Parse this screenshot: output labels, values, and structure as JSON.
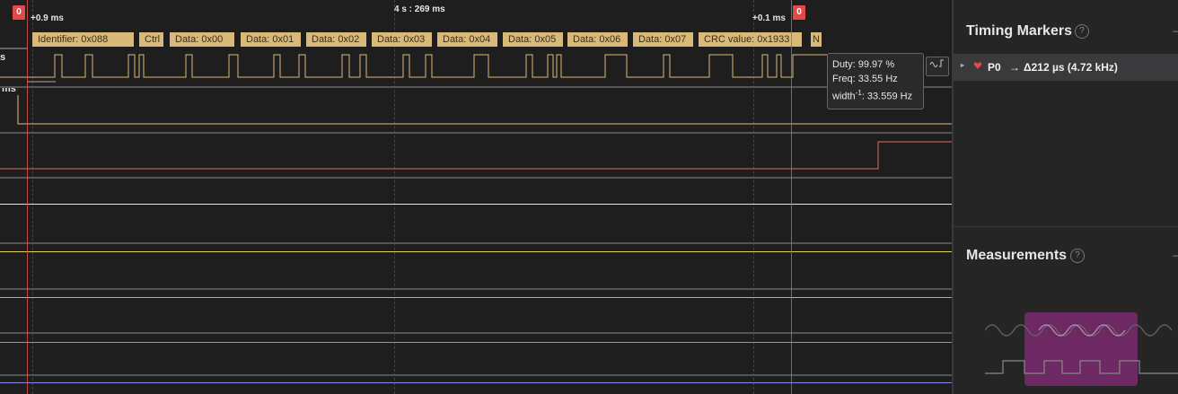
{
  "header": {
    "center_time": "4 s : 269 ms",
    "left_delta": "+0.9 ms",
    "right_delta": "+0.1 ms"
  },
  "markers": {
    "left_flag": "0",
    "right_flag": "0"
  },
  "left_labels": {
    "row1": "s",
    "row2": "ms"
  },
  "packets": [
    "Identifier: 0x088",
    "Ctrl",
    "Data: 0x00",
    "Data: 0x01",
    "Data: 0x02",
    "Data: 0x03",
    "Data: 0x04",
    "Data: 0x05",
    "Data: 0x06",
    "Data: 0x07",
    "CRC value: 0x1933",
    "N"
  ],
  "tooltip": {
    "duty": "Duty: 99.97 %",
    "freq": "Freq: 33.55 Hz",
    "width_prefix": "width",
    "width_sup": "-1",
    "width_value": ": 33.559 Hz"
  },
  "colors": {
    "trace_can": "#d9b97a",
    "trace_orange": "#e8b87a",
    "trace_red": "#e06a6a",
    "trace_yellow_light": "#f0e6b0",
    "trace_yellow": "#e8d060",
    "trace_green": "#7cd07a",
    "trace_blue": "#6a9ee8",
    "trace_purple": "#8a8ae8",
    "marker": "#e04a4a",
    "accent_purple": "#7a2a6e"
  },
  "sidebar": {
    "timing_title": "Timing Markers",
    "help_glyph": "?",
    "marker_row": {
      "name": "P0",
      "arrow": "→",
      "value": "Δ212 µs (4.72 kHz)"
    },
    "measurements_title": "Measurements"
  }
}
